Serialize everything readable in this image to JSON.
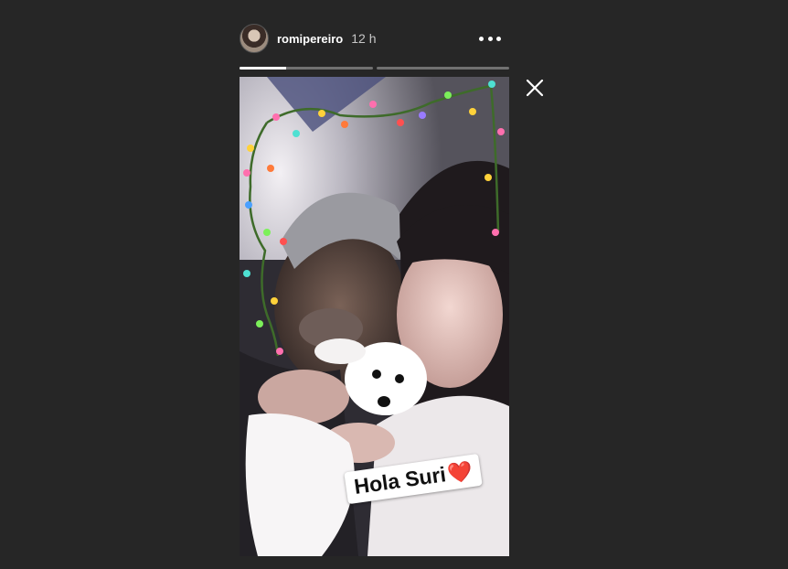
{
  "header": {
    "username": "romipereiro",
    "timestamp": "12 h",
    "more_icon": "more-horizontal-icon"
  },
  "progress": {
    "segments": [
      {
        "fill": 0.35
      },
      {
        "fill": 0.0
      }
    ]
  },
  "controls": {
    "close_icon": "close-icon"
  },
  "story": {
    "sticker_text": "Hola Suri",
    "sticker_emoji": "❤️"
  },
  "colors": {
    "background": "#262626",
    "text": "#ffffff",
    "muted": "#c7c7c7"
  }
}
